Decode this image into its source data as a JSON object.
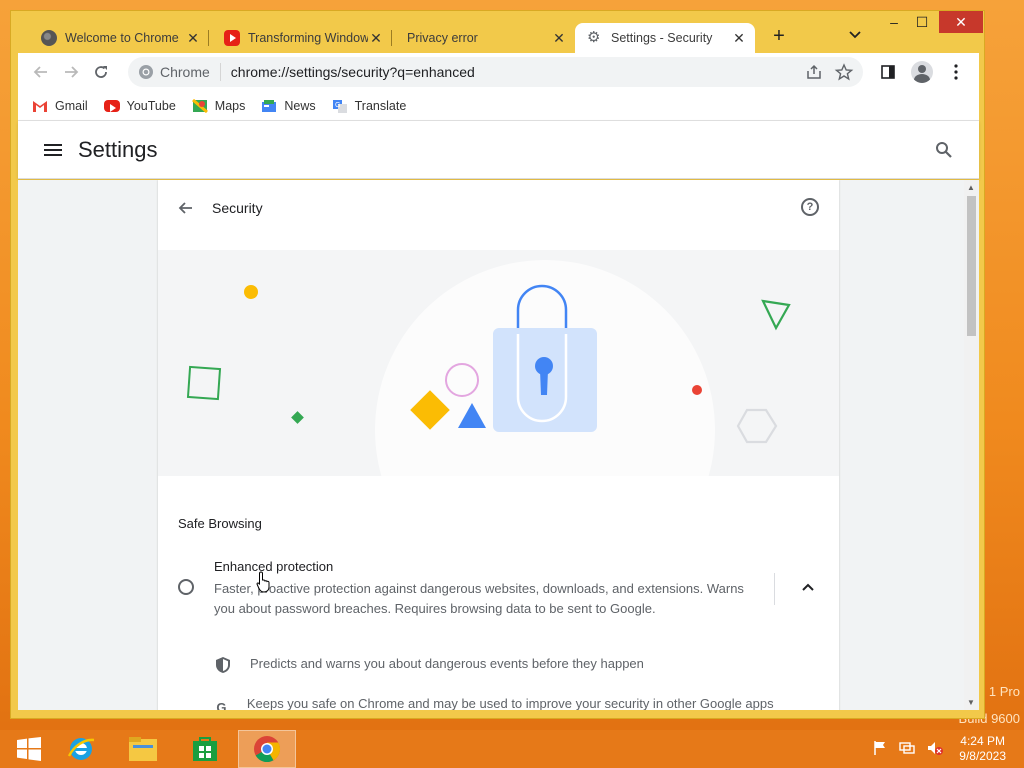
{
  "window": {
    "tabs": [
      {
        "title": "Welcome to Chrome",
        "icon": "globe-icon"
      },
      {
        "title": "Transforming Window",
        "icon": "youtube-icon"
      },
      {
        "title": "Privacy error",
        "icon": "none"
      },
      {
        "title": "Settings - Security",
        "icon": "gear-icon",
        "active": true
      }
    ],
    "new_tab": "+",
    "tab_search": "⌄",
    "controls": {
      "minimize": "–",
      "maximize": "☐",
      "close": "✕"
    }
  },
  "toolbar": {
    "site_label": "Chrome",
    "url": "chrome://settings/security?q=enhanced"
  },
  "bookmarks": [
    {
      "label": "Gmail",
      "icon": "gmail-icon"
    },
    {
      "label": "YouTube",
      "icon": "youtube-icon"
    },
    {
      "label": "Maps",
      "icon": "maps-icon"
    },
    {
      "label": "News",
      "icon": "news-icon"
    },
    {
      "label": "Translate",
      "icon": "translate-icon"
    }
  ],
  "settings": {
    "title": "Settings",
    "section_title": "Security",
    "safe_browsing": "Safe Browsing",
    "enhanced": {
      "title": "Enhanced protection",
      "description": "Faster, proactive protection against dangerous websites, downloads, and extensions. Warns you about password breaches. Requires browsing data to be sent to Google."
    },
    "features": [
      {
        "text": "Predicts and warns you about dangerous events before they happen",
        "icon": "shield-icon"
      },
      {
        "text": "Keeps you safe on Chrome and may be used to improve your security in other Google apps when you are signed in",
        "icon": "google-g-icon"
      }
    ]
  },
  "colors": {
    "accent_blue": "#4285f4",
    "yellow": "#fbbc04",
    "green": "#34a853",
    "red": "#ea4335",
    "window_frame": "#f2c94a",
    "taskbar": "#e67a19"
  },
  "taskbar": {
    "time": "4:24 PM",
    "date": "9/8/2023"
  },
  "watermark": {
    "line1": "1 Pro",
    "line2": "Build 9600"
  }
}
